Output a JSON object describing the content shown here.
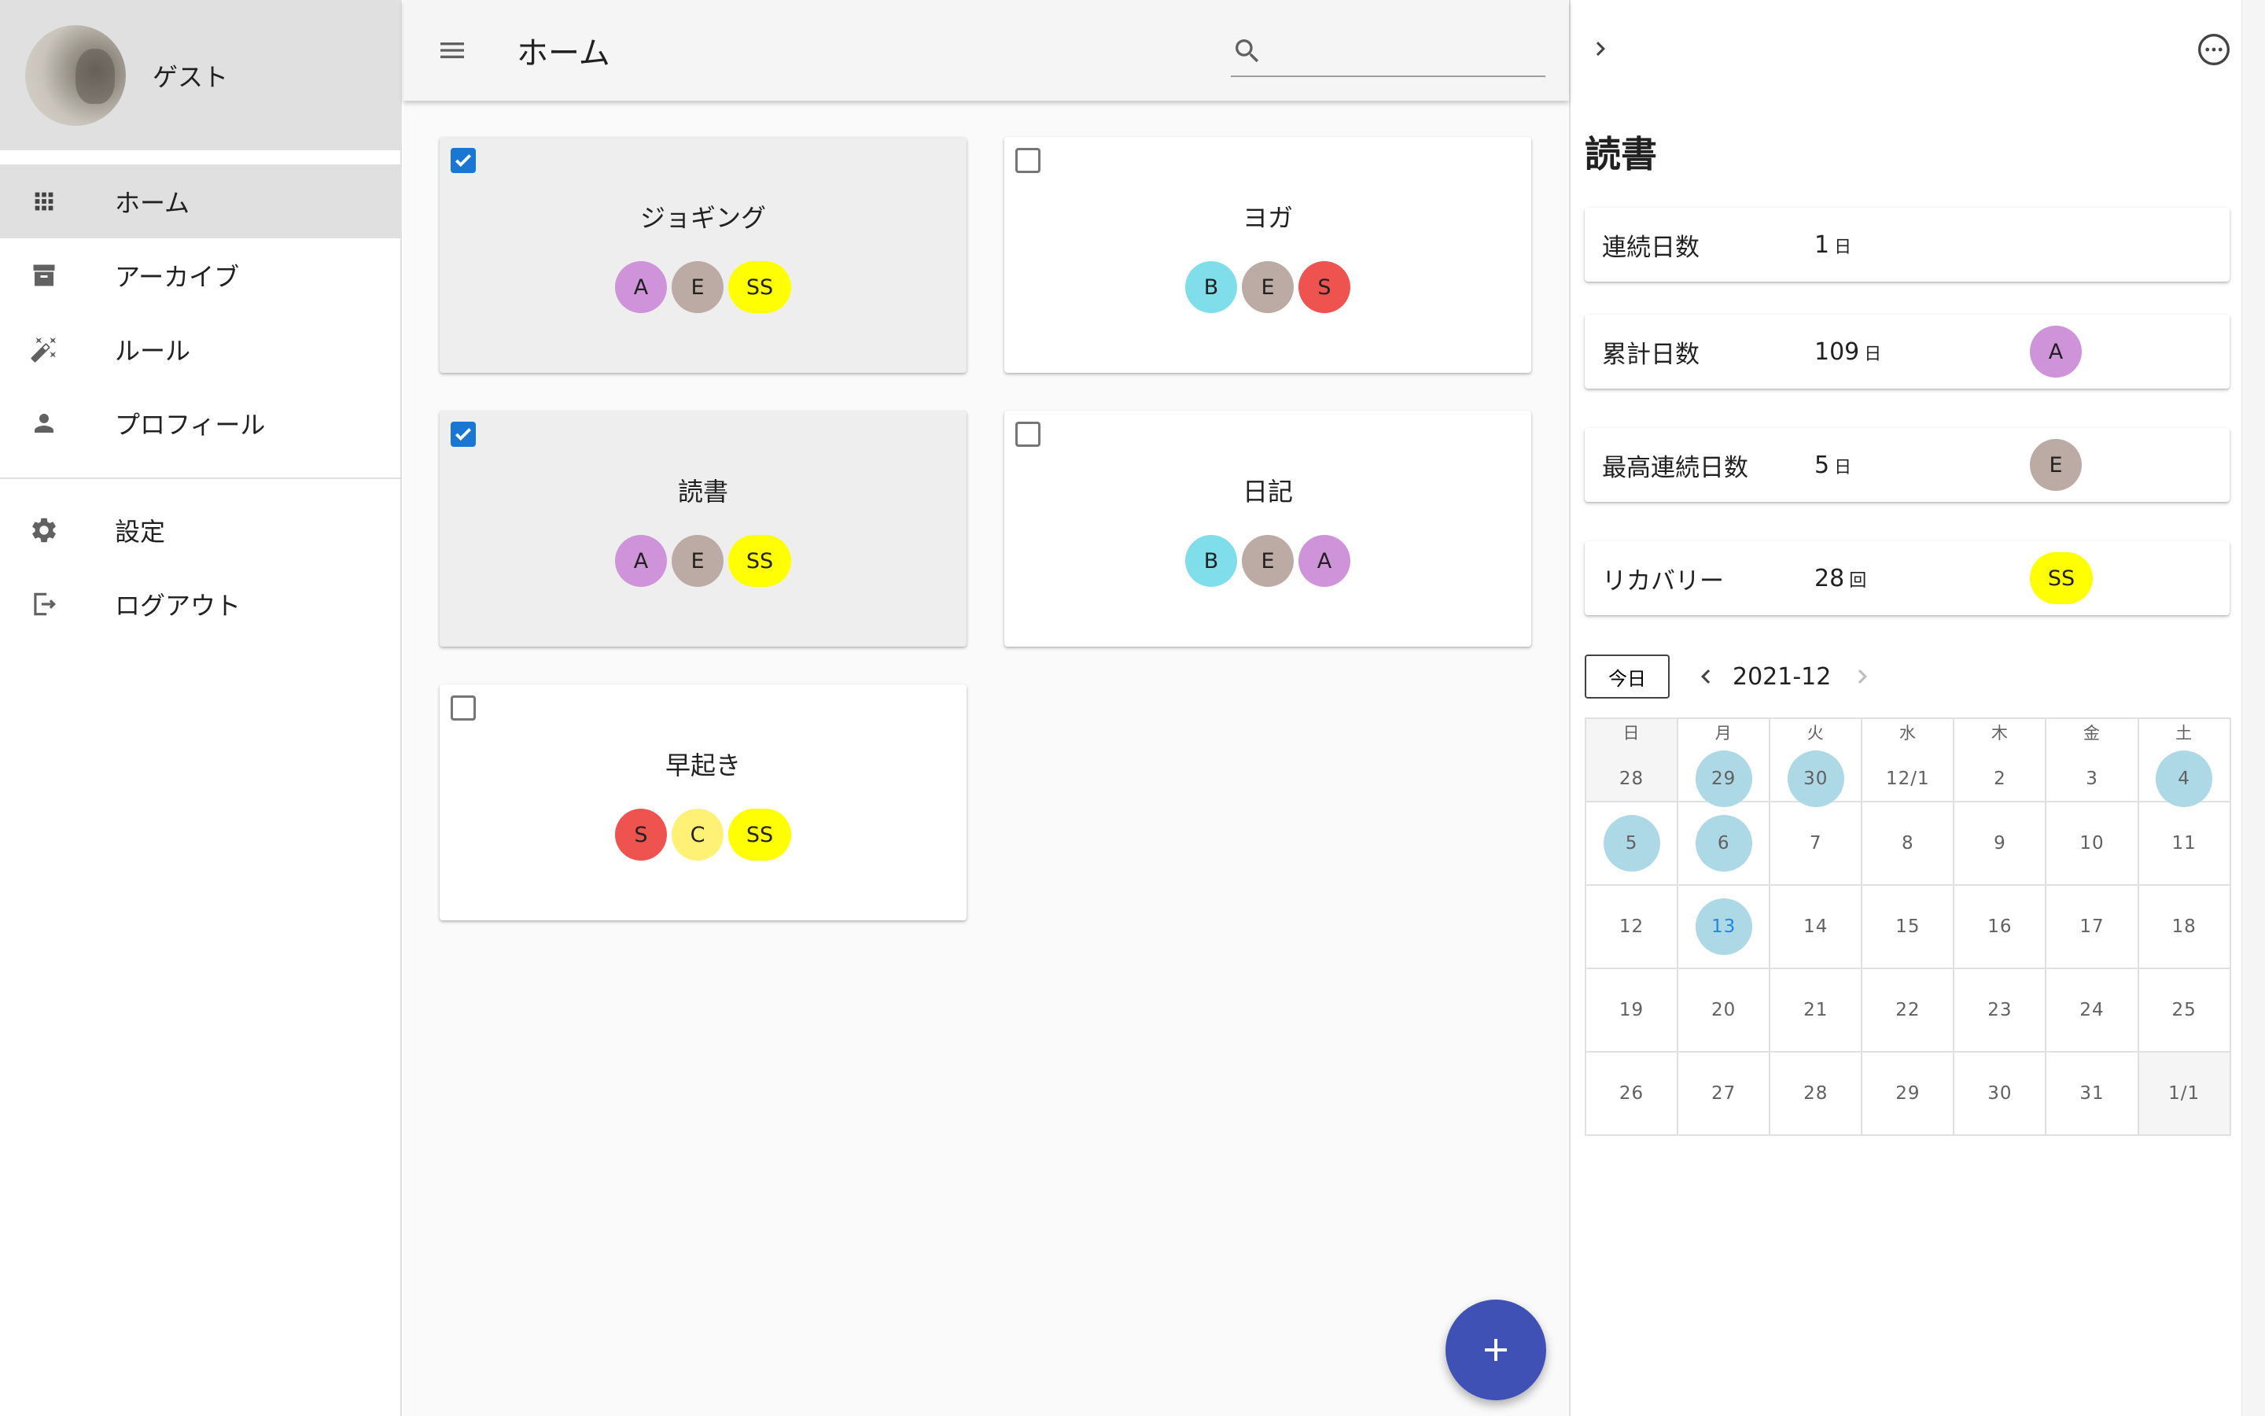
{
  "sidebar": {
    "user_name": "ゲスト",
    "nav": [
      {
        "label": "ホーム",
        "icon": "apps-grid-icon",
        "active": true
      },
      {
        "label": "アーカイブ",
        "icon": "archive-icon",
        "active": false
      },
      {
        "label": "ルール",
        "icon": "magic-wand-icon",
        "active": false
      },
      {
        "label": "プロフィール",
        "icon": "person-icon",
        "active": false
      }
    ],
    "nav2": [
      {
        "label": "設定",
        "icon": "gear-icon"
      },
      {
        "label": "ログアウト",
        "icon": "logout-icon"
      }
    ]
  },
  "appbar": {
    "title": "ホーム",
    "search_value": ""
  },
  "colors": {
    "A": "#ce93d8",
    "E": "#bcaaa4",
    "SS": "#ffff00",
    "B": "#80deea",
    "S": "#ef5350",
    "C": "#fff176",
    "fab": "#3f51b5",
    "highlight": "#add8e6",
    "today_text": "#1e88e5",
    "checkbox": "#1976d2"
  },
  "cards": [
    {
      "title": "ジョギング",
      "checked": true,
      "chips": [
        "A",
        "E",
        "SS"
      ]
    },
    {
      "title": "ヨガ",
      "checked": false,
      "chips": [
        "B",
        "E",
        "S"
      ]
    },
    {
      "title": "読書",
      "checked": true,
      "chips": [
        "A",
        "E",
        "SS"
      ]
    },
    {
      "title": "日記",
      "checked": false,
      "chips": [
        "B",
        "E",
        "A"
      ]
    },
    {
      "title": "早起き",
      "checked": false,
      "chips": [
        "S",
        "C",
        "SS"
      ]
    }
  ],
  "detail": {
    "title": "読書",
    "stats": [
      {
        "label": "連続日数",
        "value": "1",
        "unit": "日",
        "chip": ""
      },
      {
        "label": "累計日数",
        "value": "109",
        "unit": "日",
        "chip": "A"
      },
      {
        "label": "最高連続日数",
        "value": "5",
        "unit": "日",
        "chip": "E"
      },
      {
        "label": "リカバリー",
        "value": "28",
        "unit": "回",
        "chip": "SS"
      }
    ],
    "calendar": {
      "today_label": "今日",
      "month": "2021-12",
      "weekdays": [
        "日",
        "月",
        "火",
        "水",
        "木",
        "金",
        "土"
      ],
      "weeks": [
        [
          {
            "d": "28",
            "out": true
          },
          {
            "d": "29",
            "hl": true
          },
          {
            "d": "30",
            "hl": true
          },
          {
            "d": "12/1"
          },
          {
            "d": "2"
          },
          {
            "d": "3"
          },
          {
            "d": "4",
            "hl": true
          }
        ],
        [
          {
            "d": "5",
            "hl": true
          },
          {
            "d": "6",
            "hl": true
          },
          {
            "d": "7"
          },
          {
            "d": "8"
          },
          {
            "d": "9"
          },
          {
            "d": "10"
          },
          {
            "d": "11"
          }
        ],
        [
          {
            "d": "12"
          },
          {
            "d": "13",
            "hl": true,
            "today": true
          },
          {
            "d": "14"
          },
          {
            "d": "15"
          },
          {
            "d": "16"
          },
          {
            "d": "17"
          },
          {
            "d": "18"
          }
        ],
        [
          {
            "d": "19"
          },
          {
            "d": "20"
          },
          {
            "d": "21"
          },
          {
            "d": "22"
          },
          {
            "d": "23"
          },
          {
            "d": "24"
          },
          {
            "d": "25"
          }
        ],
        [
          {
            "d": "26"
          },
          {
            "d": "27"
          },
          {
            "d": "28"
          },
          {
            "d": "29"
          },
          {
            "d": "30"
          },
          {
            "d": "31"
          },
          {
            "d": "1/1",
            "out": true
          }
        ]
      ]
    }
  }
}
